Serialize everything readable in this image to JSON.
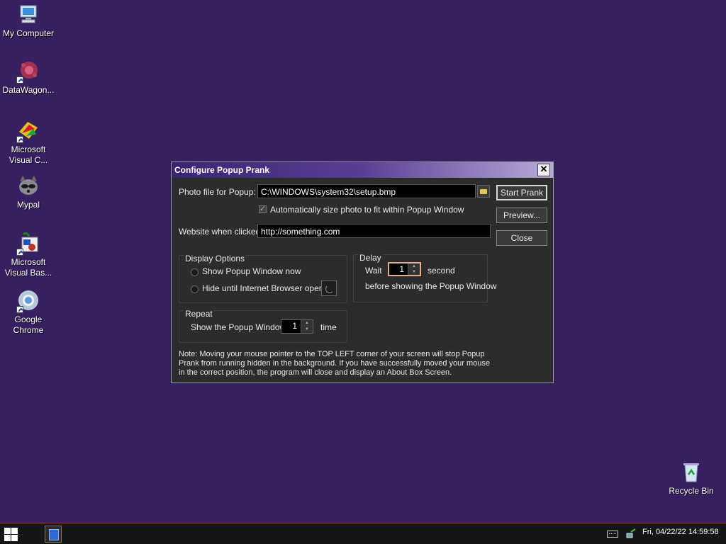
{
  "desktop": {
    "icons": [
      {
        "label": "My Computer"
      },
      {
        "label": "DataWagon..."
      },
      {
        "label": "Microsoft Visual C..."
      },
      {
        "label": "Mypal"
      },
      {
        "label": "Microsoft Visual Bas..."
      },
      {
        "label": "Google Chrome"
      },
      {
        "label": "Recycle Bin"
      }
    ]
  },
  "dialog": {
    "title": "Configure Popup Prank",
    "photo_label": "Photo file for Popup:",
    "photo_value": "C:\\WINDOWS\\system32\\setup.bmp",
    "auto_size_label": "Automatically size photo to fit within Popup Window",
    "website_label": "Website when clicked:",
    "website_value": "http://something.com",
    "buttons": {
      "start": "Start Prank",
      "preview": "Preview...",
      "close": "Close"
    },
    "display_options": {
      "title": "Display Options",
      "show_now": "Show Popup Window now",
      "hide_until": "Hide until Internet Browser opens"
    },
    "delay": {
      "title": "Delay",
      "wait_label": "Wait",
      "wait_value": "1",
      "unit": "second",
      "after": "before showing the Popup Window"
    },
    "repeat": {
      "title": "Repeat",
      "label": "Show the Popup Window",
      "value": "1",
      "unit": "time"
    },
    "note": "Note: Moving your mouse pointer to the TOP LEFT corner of your screen will stop Popup Prank from running hidden in the background. If you have successfully moved your mouse in the correct position, the program will close and display an About Box Screen."
  },
  "taskbar": {
    "clock": "Fri, 04/22/22 14:59:58"
  }
}
